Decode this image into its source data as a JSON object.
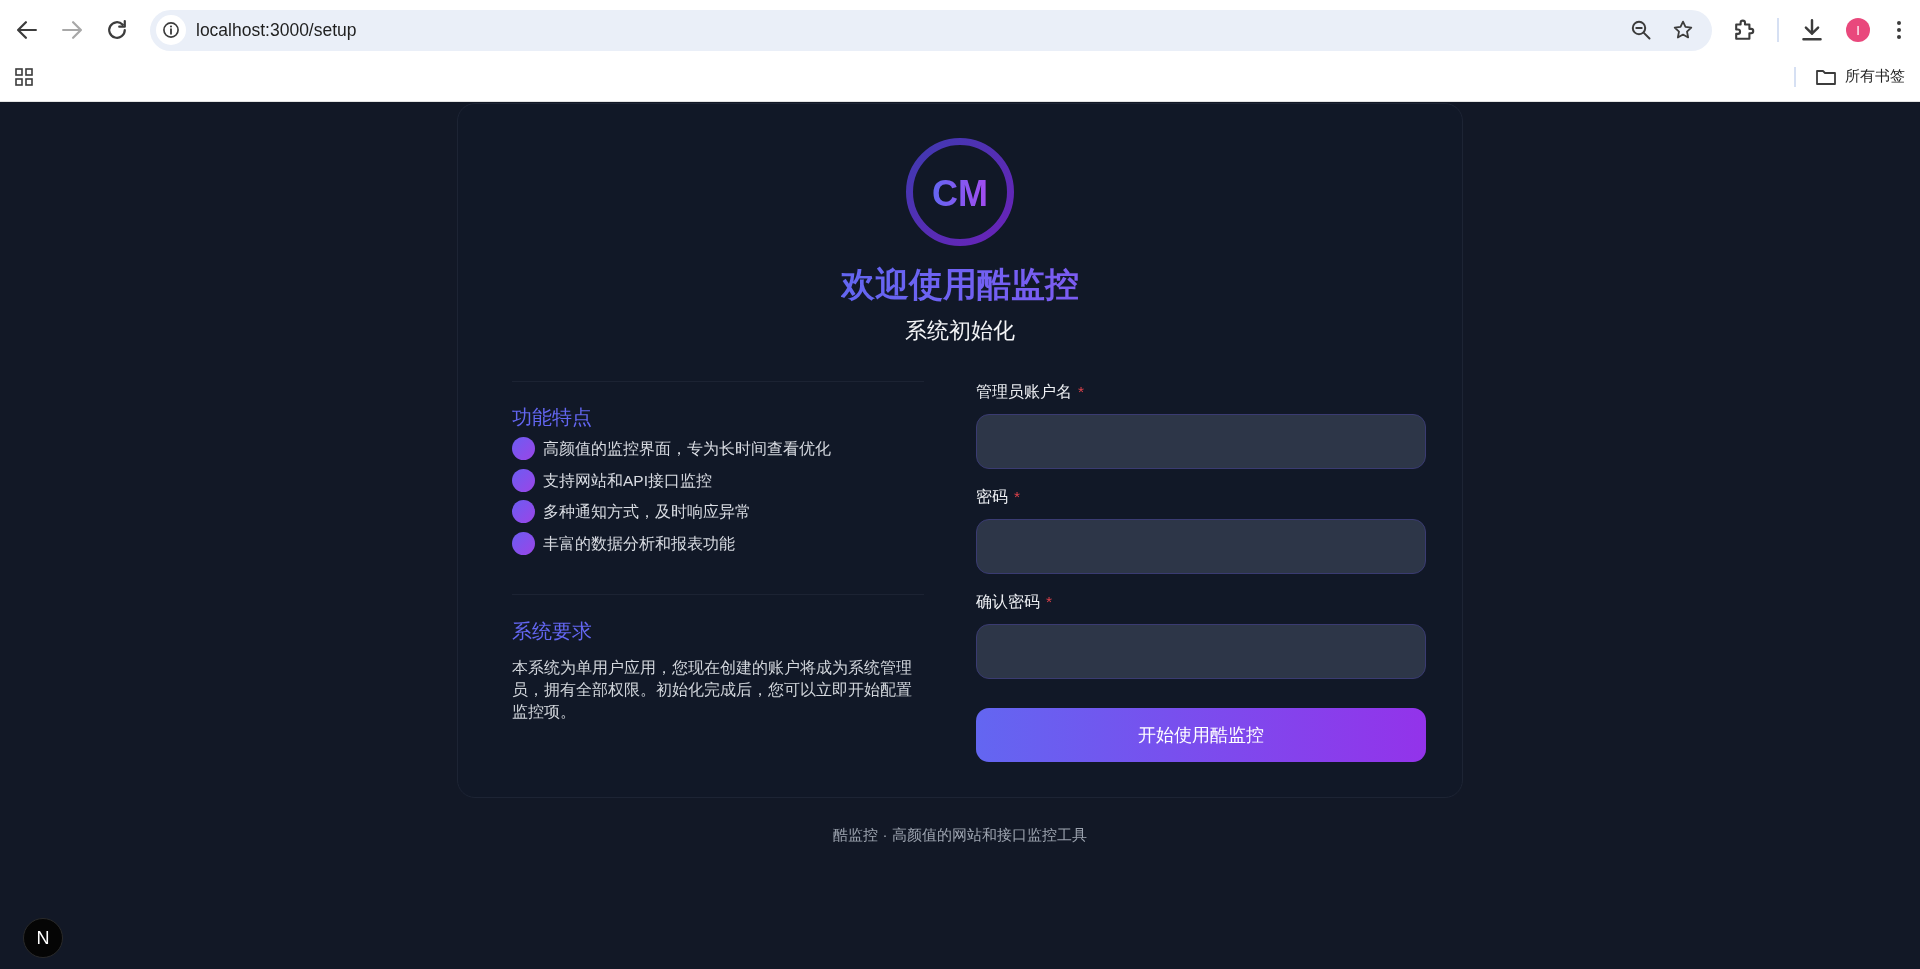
{
  "browser": {
    "nav_buttons": [
      {
        "kind": "back",
        "disabled": false
      },
      {
        "kind": "forward",
        "disabled": true
      },
      {
        "kind": "reload",
        "disabled": false
      }
    ],
    "address": "localhost:3000/setup",
    "profile_initial": "I",
    "bookmarks": [
      {
        "kind": "folder",
        "label": "所有书签"
      }
    ]
  },
  "header": {
    "logo": "CM",
    "title": "欢迎使用酷监控",
    "subtitle": "系统初始化"
  },
  "features": {
    "title": "功能特点",
    "items": [
      "高颜值的监控界面，专为长时间查看优化",
      "支持网站和API接口监控",
      "多种通知方式，及时响应异常",
      "丰富的数据分析和报表功能"
    ]
  },
  "requirements": {
    "title": "系统要求",
    "text": "本系统为单用户应用，您现在创建的账户将成为系统管理员，拥有全部权限。初始化完成后，您可以立即开始配置监控项。"
  },
  "form": {
    "fields": [
      {
        "label": "管理员账户名",
        "required_mark": "*"
      },
      {
        "label": "密码",
        "required_mark": "*"
      },
      {
        "label": "确认密码",
        "required_mark": "*"
      }
    ],
    "submit": "开始使用酷监控"
  },
  "footer": "酷监控 · 高颜值的网站和接口监控工具",
  "dev_badge": "N"
}
